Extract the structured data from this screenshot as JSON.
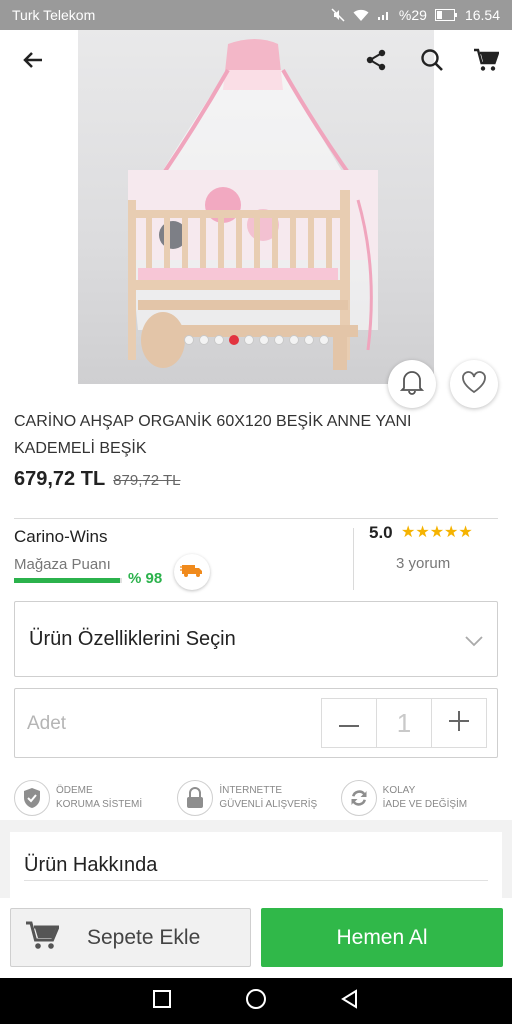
{
  "status_bar": {
    "carrier": "Turk Telekom",
    "battery": "%29",
    "time": "16.54"
  },
  "toolbar": {
    "back_icon": "arrow-left-icon",
    "share_icon": "share-icon",
    "search_icon": "search-icon",
    "cart_icon": "cart-icon"
  },
  "gallery": {
    "image_count": 10,
    "active_index": 3
  },
  "product": {
    "title": "CARİNO AHŞAP ORGANİK 60X120 BEŞİK ANNE YANI KADEMELİ BEŞİK",
    "price": "679,72 TL",
    "old_price": "879,72 TL"
  },
  "seller": {
    "name": "Carino-Wins",
    "score_label": "Mağaza Puanı",
    "score_percent": "% 98",
    "score_value": 98,
    "rating": "5.0",
    "stars": "★★★★★",
    "reviews": "3 yorum"
  },
  "options": {
    "select_label": "Ürün Özelliklerini Seçin"
  },
  "quantity": {
    "label": "Adet",
    "value": "1",
    "minus": "−",
    "plus": "+"
  },
  "guarantees": [
    {
      "icon": "shield-check-icon",
      "line1": "ÖDEME",
      "line2": "KORUMA SİSTEMİ"
    },
    {
      "icon": "lock-icon",
      "line1": "İNTERNETTE",
      "line2": "GÜVENLİ ALIŞVERİŞ"
    },
    {
      "icon": "refresh-icon",
      "line1": "KOLAY",
      "line2": "İADE VE DEĞİŞİM"
    }
  ],
  "about": {
    "title": "Ürün Hakkında"
  },
  "actions": {
    "add_to_cart": "Sepete Ekle",
    "buy_now": "Hemen Al"
  },
  "colors": {
    "accent_green": "#30b849",
    "active_dot": "#e2343f",
    "star": "#f5b301"
  }
}
